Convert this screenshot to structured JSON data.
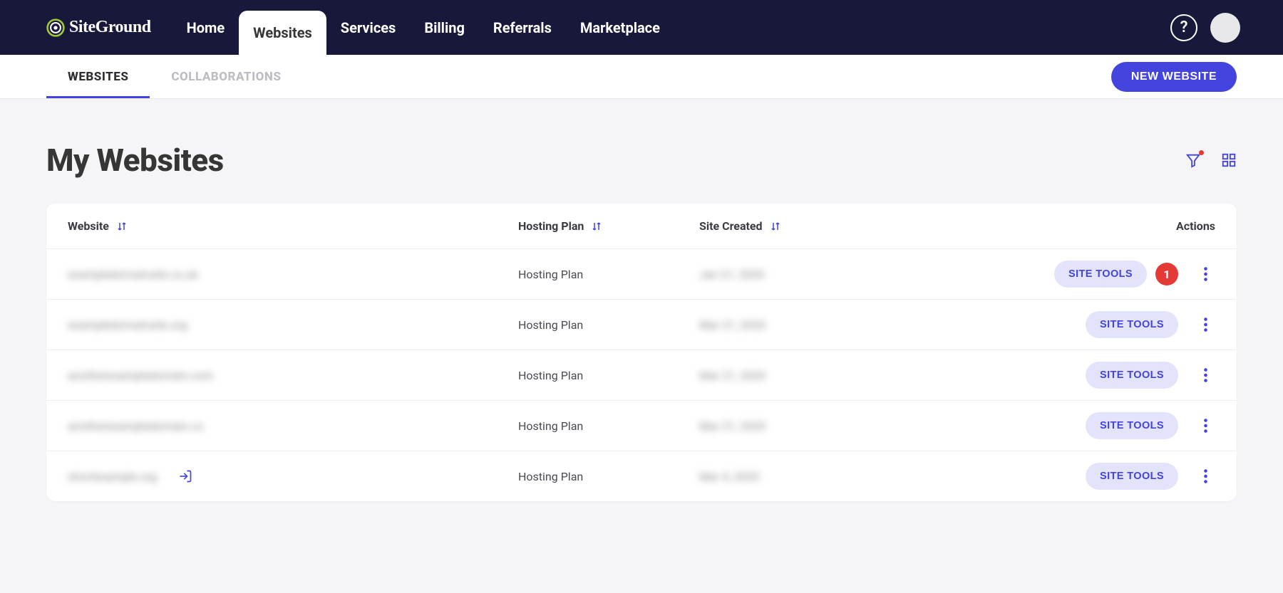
{
  "brand": {
    "name": "SiteGround"
  },
  "nav": {
    "items": [
      {
        "label": "Home"
      },
      {
        "label": "Websites",
        "active": true
      },
      {
        "label": "Services"
      },
      {
        "label": "Billing"
      },
      {
        "label": "Referrals"
      },
      {
        "label": "Marketplace"
      }
    ]
  },
  "subnav": {
    "tabs": [
      {
        "label": "WEBSITES",
        "active": true
      },
      {
        "label": "COLLABORATIONS"
      }
    ],
    "new_button": "NEW WEBSITE"
  },
  "page": {
    "title": "My Websites"
  },
  "table": {
    "headers": {
      "website": "Website",
      "plan": "Hosting Plan",
      "created": "Site Created",
      "actions": "Actions"
    },
    "site_tools_label": "SITE TOOLS",
    "rows": [
      {
        "domain": "exampledomainsite.co.uk",
        "plan": "Hosting Plan",
        "created": "Jan 21, 2020",
        "notification": "1"
      },
      {
        "domain": "exampledomainsite.org",
        "plan": "Hosting Plan",
        "created": "Mar 21, 2020"
      },
      {
        "domain": "anotherexampledomain.com",
        "plan": "Hosting Plan",
        "created": "Mar 21, 2020"
      },
      {
        "domain": "anotherexampledomain.co",
        "plan": "Hosting Plan",
        "created": "Mar 21, 2020"
      },
      {
        "domain": "shortexample.org",
        "plan": "Hosting Plan",
        "created": "Mar 4, 2020",
        "login_icon": true
      }
    ]
  }
}
